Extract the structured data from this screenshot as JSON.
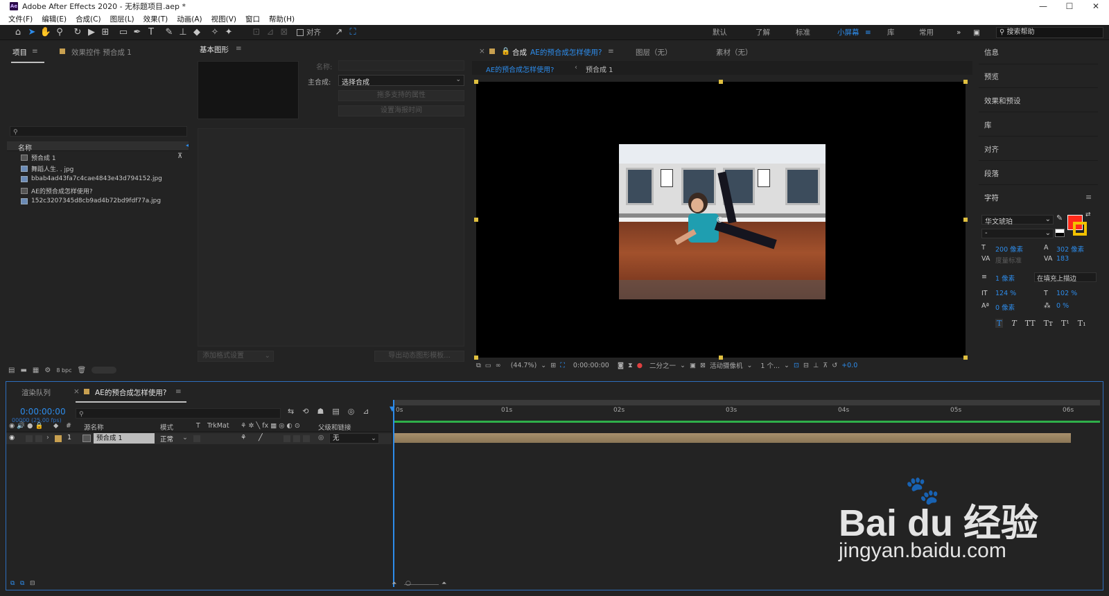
{
  "window": {
    "title": "Adobe After Effects 2020 - 无标题项目.aep *",
    "logo_text": "Ae",
    "controls": [
      "—",
      "☐",
      "✕"
    ]
  },
  "menu": [
    "文件(F)",
    "编辑(E)",
    "合成(C)",
    "图层(L)",
    "效果(T)",
    "动画(A)",
    "视图(V)",
    "窗口",
    "帮助(H)"
  ],
  "toolbar": {
    "align_label": "对齐",
    "workspaces": [
      "默认",
      "了解",
      "标准",
      "小屏幕",
      "库",
      "常用"
    ],
    "active_workspace": "小屏幕",
    "more": "»",
    "search_placeholder": "搜索帮助"
  },
  "project_panel": {
    "tab_project": "项目",
    "tab_effects": "效果控件 预合成 1",
    "col_name": "名称",
    "items": [
      {
        "name": "预合成 1",
        "type": "comp"
      },
      {
        "name": "舞蹈人生. . jpg",
        "type": "image"
      },
      {
        "name": "bbab4ad43fa7c4cae4843e43d794152.jpg",
        "type": "image"
      },
      {
        "name": "AE的预合成怎样使用?",
        "type": "comp"
      },
      {
        "name": "152c3207345d8cb9ad4b72bd9fdf77a.jpg",
        "type": "image"
      }
    ],
    "bpc": "8 bpc"
  },
  "essential_graphics": {
    "tab": "基本图形",
    "name_label": "名称:",
    "master_label": "主合成:",
    "master_value": "选择合成",
    "add_props_btn": "拖多支持的属性",
    "set_poster_btn": "设置海报时间",
    "add_format_btn": "添加格式设置",
    "export_btn": "导出动态图形模板..."
  },
  "comp_panel": {
    "tab_label": "合成",
    "comp_name": "AE的预合成怎样使用?",
    "layer_tab": "图层（无）",
    "footage_tab": "素材（无）",
    "breadcrumb_1": "AE的预合成怎样使用?",
    "breadcrumb_2": "预合成 1",
    "zoom": "(44.7%)",
    "timecode": "0:00:00:00",
    "resolution": "二分之一",
    "camera": "活动摄像机",
    "views": "1 个...",
    "exposure": "+0.0"
  },
  "right_panel": {
    "items": [
      "信息",
      "预览",
      "效果和预设",
      "库",
      "对齐",
      "段落"
    ],
    "character_title": "字符",
    "font": "华文琥珀",
    "font_style": "-",
    "size": "200 像素",
    "leading": "302 像素",
    "kerning": "度量标准",
    "tracking": "183",
    "stroke_width": "1 像素",
    "stroke_mode": "在填充上描边",
    "vscale": "124 %",
    "hscale": "102 %",
    "baseline": "0 像素",
    "tsume": "0 %",
    "fill_color": "#ff2a1a",
    "stroke_color": "#f2c200"
  },
  "timeline": {
    "tab_render": "渲染队列",
    "tab_comp": "AE的预合成怎样使用?",
    "timecode": "0:00:00:00",
    "fps": "00000 (25.00 fps)",
    "col_source": "源名称",
    "col_mode": "模式",
    "col_t": "T",
    "col_trkmat": "TrkMat",
    "col_parent": "父级和链接",
    "layer": {
      "index": "1",
      "name": "预合成 1",
      "mode": "正常",
      "parent": "无"
    },
    "ruler": [
      "0s",
      "01s",
      "02s",
      "03s",
      "04s",
      "05s",
      "06s"
    ]
  },
  "watermark": {
    "brand": "Bai du 经验",
    "url": "jingyan.baidu.com"
  }
}
